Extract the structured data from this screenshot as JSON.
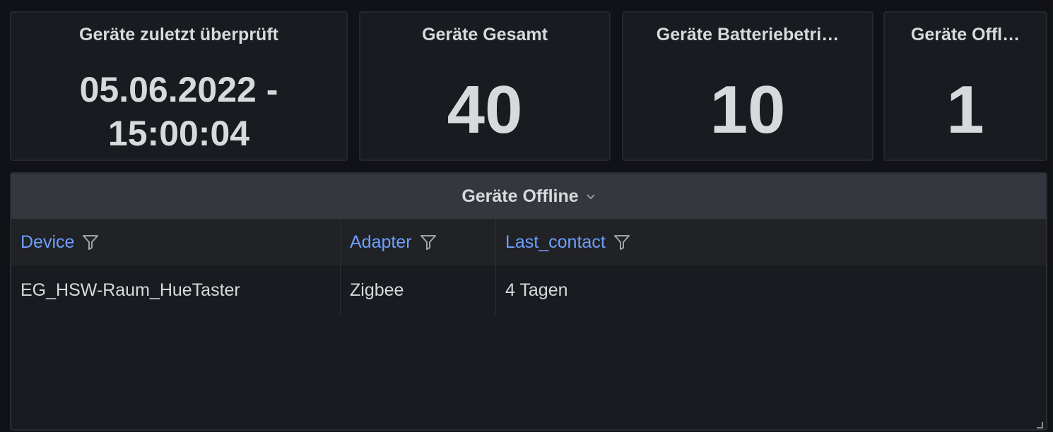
{
  "stats": [
    {
      "title": "Geräte zuletzt überprüft",
      "value": "05.06.2022 - 15:00:04"
    },
    {
      "title": "Geräte Gesamt",
      "value": "40"
    },
    {
      "title": "Geräte Batteriebetri…",
      "value": "10"
    },
    {
      "title": "Geräte Offl…",
      "value": "1"
    }
  ],
  "table": {
    "title": "Geräte Offline",
    "columns": [
      "Device",
      "Adapter",
      "Last_contact"
    ],
    "rows": [
      [
        "EG_HSW-Raum_HueTaster",
        "Zigbee",
        "4 Tagen"
      ]
    ]
  },
  "colors": {
    "background": "#111217",
    "panel": "#181b1f",
    "header_link": "#6e9fff",
    "text": "#d8d9dc"
  }
}
